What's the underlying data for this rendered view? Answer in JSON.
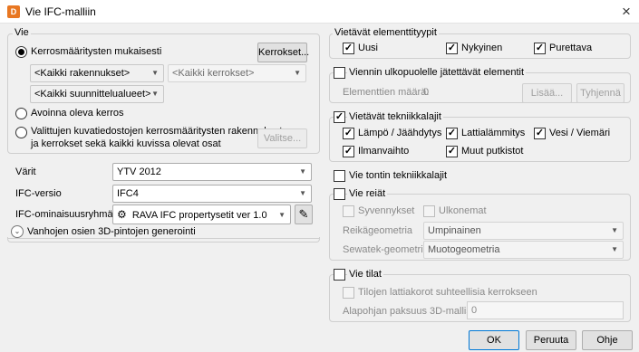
{
  "window": {
    "title": "Vie IFC-malliin",
    "app_icon_letter": "D",
    "close_symbol": "×"
  },
  "vie": {
    "legend": "Vie",
    "radio_floor_defs": "Kerrosmääritysten mukaisesti",
    "floors_button": "Kerrokset...",
    "combo_buildings": "<Kaikki rakennukset>",
    "combo_floors": "<Kaikki kerrokset>",
    "combo_planning": "<Kaikki suunnittelualueet>",
    "radio_open_floor": "Avoinna oleva kerros",
    "radio_selected_line1": "Valittujen kuvatiedostojen kerrosmääritysten rakennukset",
    "radio_selected_line2": "ja kerrokset sekä kaikki kuvissa olevat osat",
    "select_button": "Valitse..."
  },
  "settings": {
    "colors_label": "Värit",
    "colors_value": "YTV 2012",
    "version_label": "IFC-versio",
    "version_value": "IFC4",
    "property_label": "IFC-ominaisuusryhmät:",
    "property_value": "RAVA IFC propertysetit ver 1.0"
  },
  "old3d": {
    "label": "Vanhojen osien 3D-pintojen generointi"
  },
  "element_types": {
    "legend": "Vietävät elementtityypit",
    "new": "Uusi",
    "existing": "Nykyinen",
    "demolish": "Purettava"
  },
  "excluded": {
    "legend": "Viennin ulkopuolelle jätettävät elementit",
    "count_label": "Elementtien määrä:",
    "count_value": "0",
    "add_button": "Lisää...",
    "clear_button": "Tyhjennä"
  },
  "technical": {
    "legend": "Vietävät tekniikkalajit",
    "heating": "Lämpö / Jäähdytys",
    "floor_heating": "Lattialämmitys",
    "water": "Vesi / Viemäri",
    "ventilation": "Ilmanvaihto",
    "other_pipes": "Muut putkistot"
  },
  "site_tech": {
    "label": "Vie tontin tekniikkalajit"
  },
  "holes": {
    "legend": "Vie reiät",
    "recesses": "Syvennykset",
    "protrusions": "Ulkonemat",
    "hole_geom_label": "Reikägeometria",
    "hole_geom_value": "Umpinainen",
    "sewatek_label": "Sewatek-geometria",
    "sewatek_value": "Muotogeometria"
  },
  "spaces": {
    "legend": "Vie tilat",
    "relative_floors": "Tilojen lattiakorot suhteellisia kerrokseen",
    "base_thickness_label": "Alapohjan paksuus 3D-mallissa",
    "base_thickness_value": "0"
  },
  "footer": {
    "ok": "OK",
    "cancel": "Peruuta",
    "help": "Ohje"
  },
  "icons": {
    "check": "✓",
    "dropdown": "▼",
    "expand": "⌄",
    "gear": "⚙",
    "edit": "✎"
  }
}
